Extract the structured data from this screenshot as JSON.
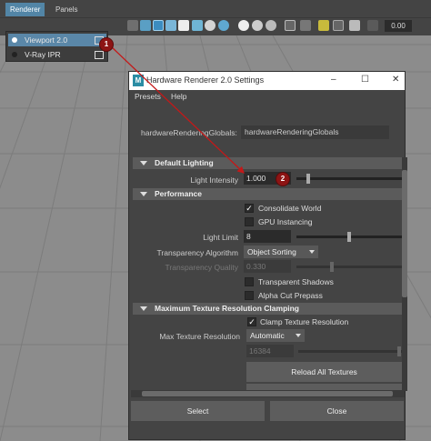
{
  "main_menu": {
    "renderer_tab": "Renderer",
    "panels_tab": "Panels"
  },
  "toolbar": {
    "zoom_value": "0.00"
  },
  "renderer_menu": {
    "items": [
      {
        "label": "Viewport 2.0",
        "selected": true
      },
      {
        "label": "V-Ray IPR",
        "selected": false
      }
    ]
  },
  "badges": {
    "one": "1",
    "two": "2"
  },
  "dialog": {
    "title": "Hardware Renderer 2.0 Settings",
    "menus": [
      "Presets",
      "Help"
    ],
    "window_buttons": {
      "minimize": "–",
      "maximize": "☐",
      "close": "✕"
    },
    "globals_label": "hardwareRenderingGlobals:",
    "globals_value": "hardwareRenderingGlobals",
    "sections": {
      "default_lighting": {
        "title": "Default Lighting",
        "light_intensity_label": "Light Intensity",
        "light_intensity_value": "1.000",
        "light_intensity_fraction": 0.1
      },
      "performance": {
        "title": "Performance",
        "consolidate_world": {
          "label": "Consolidate World",
          "checked": true
        },
        "gpu_instancing": {
          "label": "GPU Instancing",
          "checked": false
        },
        "light_limit_label": "Light Limit",
        "light_limit_value": "8",
        "light_limit_fraction": 0.5,
        "transparency_algorithm_label": "Transparency Algorithm",
        "transparency_algorithm_value": "Object Sorting",
        "transparency_quality_label": "Transparency Quality",
        "transparency_quality_value": "0.330",
        "transparency_quality_fraction": 0.33,
        "transparent_shadows": {
          "label": "Transparent Shadows",
          "checked": false
        },
        "alpha_cut_prepass": {
          "label": "Alpha Cut Prepass",
          "checked": false
        }
      },
      "max_texture": {
        "title": "Maximum Texture Resolution Clamping",
        "clamp": {
          "label": "Clamp Texture Resolution",
          "checked": true
        },
        "max_res_label": "Max Texture Resolution",
        "max_res_value": "Automatic",
        "max_res_number": "16384",
        "reload_label": "Reload All Textures"
      }
    },
    "buttons": {
      "select": "Select",
      "close": "Close"
    }
  },
  "colors": {
    "accent": "#5285a6",
    "badge": "#8d1414",
    "panel": "#444444",
    "viewport": "#8c8c8c"
  }
}
